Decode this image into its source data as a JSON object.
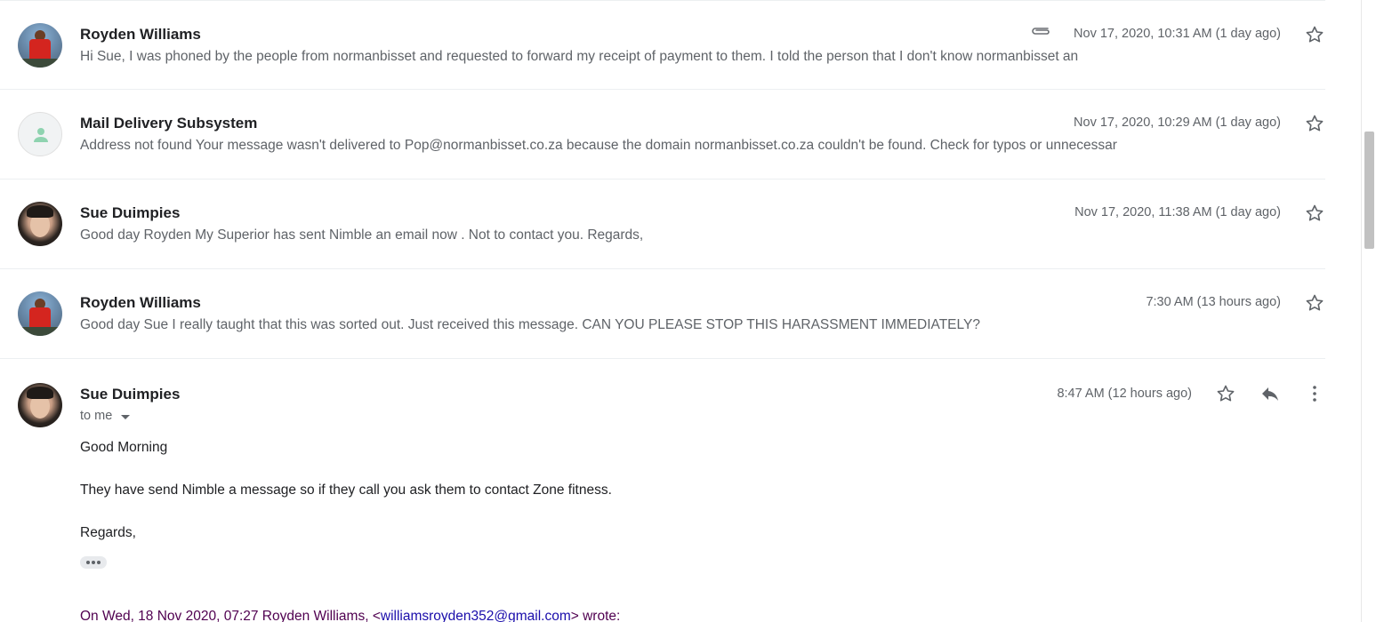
{
  "messages": [
    {
      "sender": "Royden Williams",
      "snippet": "Hi Sue, I was phoned by the people from normanbisset and requested to forward my receipt of payment to them. I told the person that I don't know normanbisset an",
      "date": "Nov 17, 2020, 10:31 AM (1 day ago)",
      "has_attachment": true,
      "avatar": "photo-red-shirt"
    },
    {
      "sender": "Mail Delivery Subsystem",
      "snippet": "Address not found Your message wasn't delivered to Pop@normanbisset.co.za because the domain normanbisset.co.za couldn't be found. Check for typos or unnecessar",
      "date": "Nov 17, 2020, 10:29 AM (1 day ago)",
      "has_attachment": false,
      "avatar": "person-icon"
    },
    {
      "sender": "Sue Duimpies",
      "snippet": "Good day Royden My Superior has sent Nimble an email now . Not to contact you. Regards,",
      "date": "Nov 17, 2020, 11:38 AM (1 day ago)",
      "has_attachment": false,
      "avatar": "photo-woman"
    },
    {
      "sender": "Royden Williams",
      "snippet": "Good day Sue I really taught that this was sorted out. Just received this message. CAN YOU PLEASE STOP THIS HARASSMENT IMMEDIATELY?",
      "date": "7:30 AM (13 hours ago)",
      "has_attachment": false,
      "avatar": "photo-red-shirt"
    }
  ],
  "expanded": {
    "sender": "Sue Duimpies",
    "recipient_label": "to me",
    "date": "8:47 AM (12 hours ago)",
    "body": [
      "Good Morning",
      "They have send Nimble a message so if they call you ask them to contact Zone fitness.",
      "Regards,"
    ],
    "quote_prefix": "On Wed, 18 Nov 2020, 07:27 Royden Williams, <",
    "quote_email": "williamsroyden352@gmail.com",
    "quote_suffix": "> wrote:"
  },
  "colors": {
    "accent_link": "#1a0dab",
    "quote_text": "#500050",
    "muted_text": "#5f6368",
    "person_icon": "#8fd3b0"
  }
}
